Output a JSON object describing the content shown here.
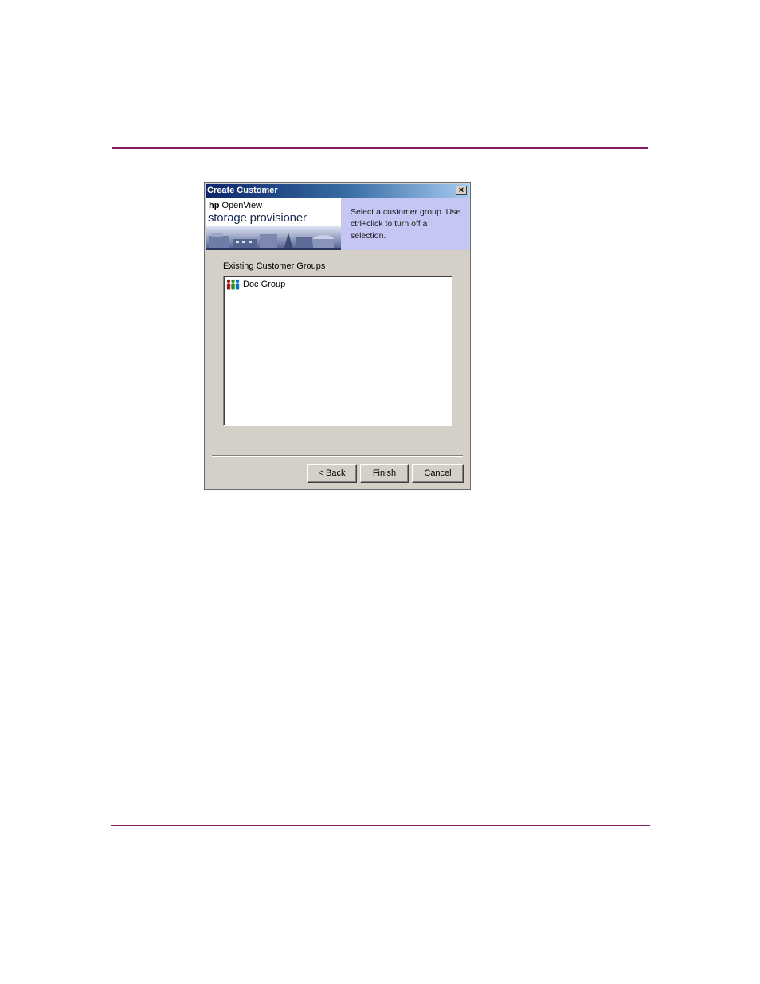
{
  "dialog": {
    "title": "Create Customer",
    "close_label": "×",
    "logo": {
      "brand": "hp",
      "product": "OpenView",
      "name": "storage provisioner"
    },
    "instructions": "Select a customer group. Use ctrl+click to turn off a selection.",
    "list_label": "Existing Customer Groups",
    "items": [
      {
        "label": "Doc Group",
        "icon": "user-group-icon"
      }
    ],
    "buttons": {
      "back": "< Back",
      "finish": "Finish",
      "cancel": "Cancel"
    }
  },
  "colors": {
    "rule": "#8c1a6b",
    "titlebar_start": "#0a246a",
    "titlebar_end": "#a6caf0",
    "banner_right": "#c6c6f4",
    "dialog_face": "#d4d0c8"
  }
}
